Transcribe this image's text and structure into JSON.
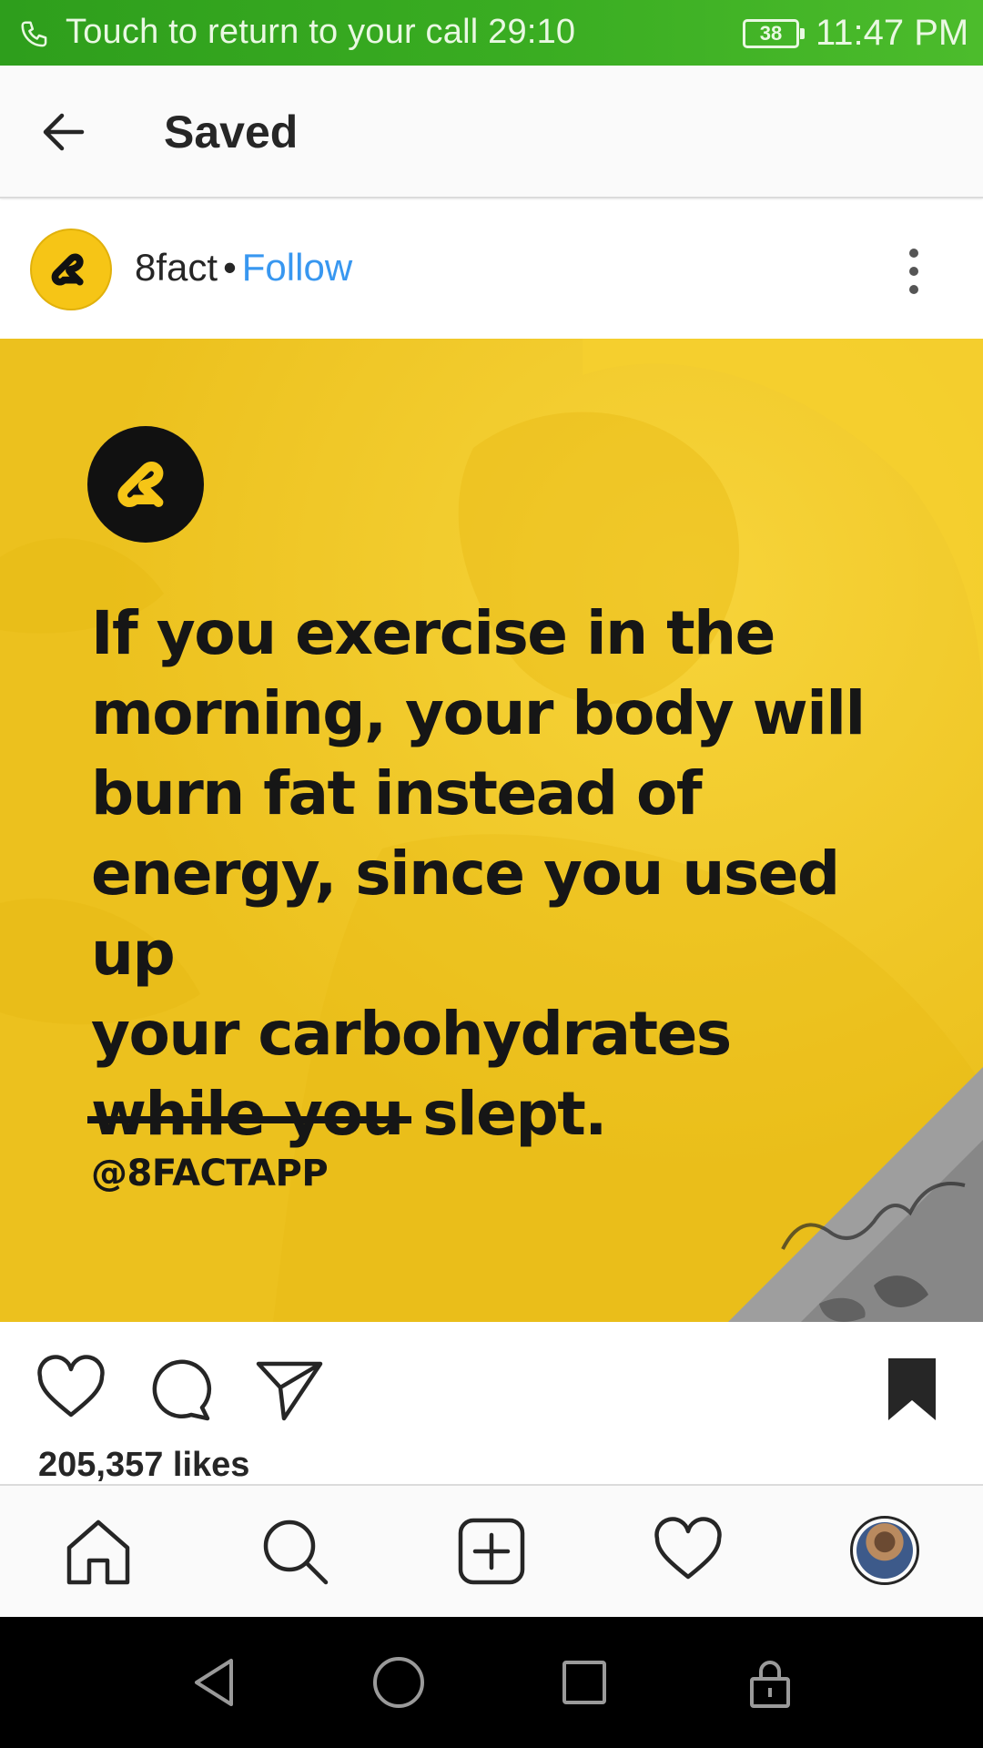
{
  "status_bar": {
    "call_text": "Touch to return to your call",
    "call_timer": "29:10",
    "battery": "38",
    "time": "11:47 PM",
    "bg_color": "#38a920"
  },
  "header": {
    "back_icon": "arrow-left-icon",
    "title": "Saved"
  },
  "post": {
    "username": "8fact",
    "separator": "•",
    "follow_label": "Follow",
    "follow_color": "#3897f0",
    "image": {
      "background_color": "#f0c521",
      "fact_lines": [
        "If you exercise in the",
        "morning, your body will",
        "burn fat instead of",
        "energy, since you used up",
        "your carbohydrates",
        "while you slept."
      ],
      "handle": "@8FACTAPP"
    },
    "likes": "205,357 likes"
  },
  "actions": {
    "like_icon": "heart-outline-icon",
    "comment_icon": "comment-bubble-icon",
    "share_icon": "paper-plane-icon",
    "save_icon": "bookmark-filled-icon"
  },
  "bottom_nav": {
    "items": [
      "home-icon",
      "search-icon",
      "new-post-icon",
      "activity-heart-icon",
      "profile-avatar"
    ]
  },
  "system_nav": {
    "items": [
      "back-triangle-icon",
      "home-circle-icon",
      "recents-square-icon",
      "lock-icon"
    ]
  }
}
